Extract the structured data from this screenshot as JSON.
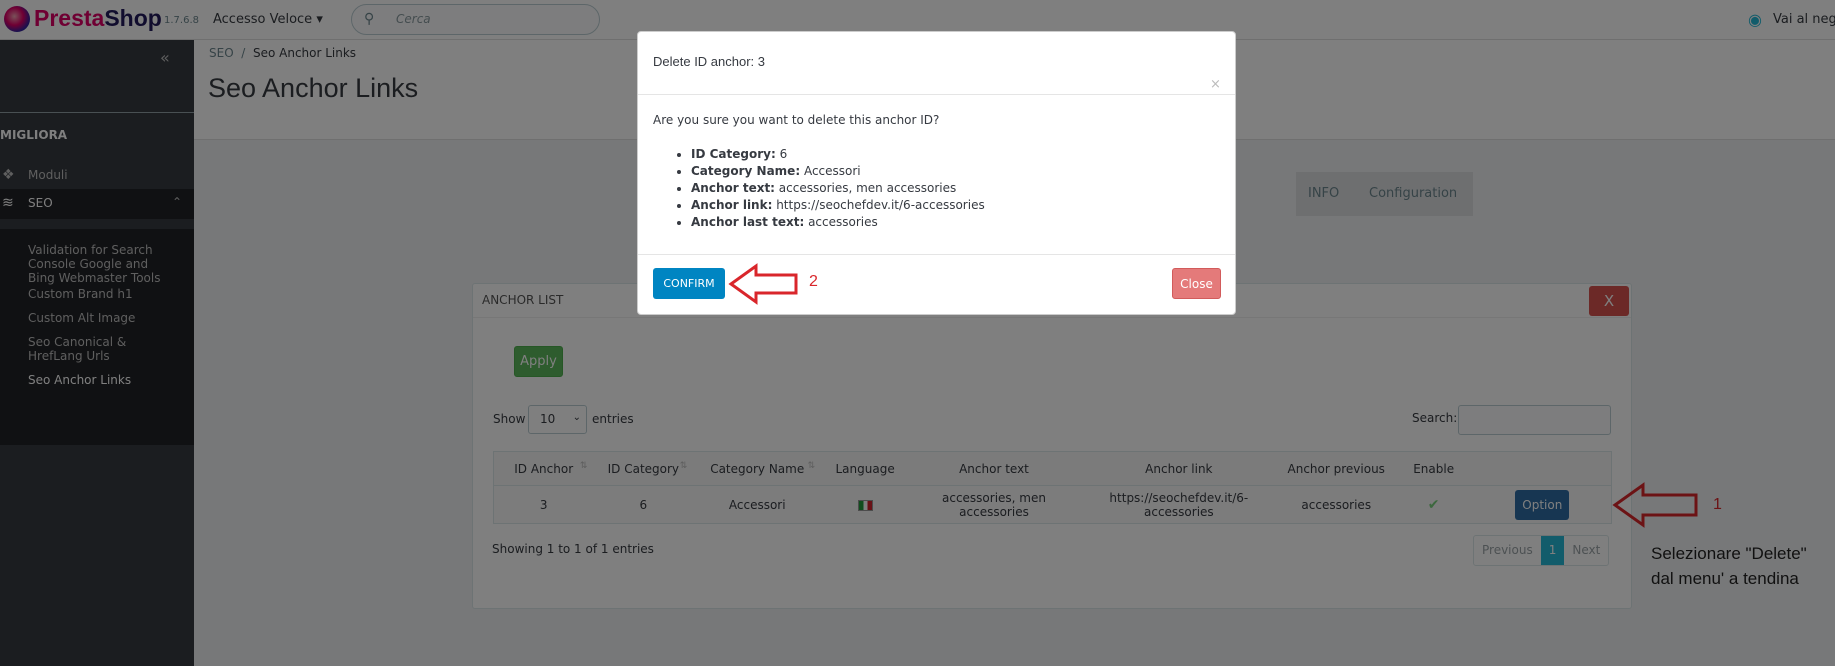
{
  "header": {
    "brand_a": "Presta",
    "brand_b": "Shop",
    "version": "1.7.6.8",
    "quick_access": "Accesso Veloce",
    "search_placeholder": "Cerca",
    "shop_link": "Vai al negozio"
  },
  "sidebar": {
    "section": "MIGLIORA",
    "items": [
      {
        "label": "Moduli",
        "icon": "puzzle-icon"
      },
      {
        "label": "SEO",
        "icon": "seo-icon"
      }
    ],
    "submenu": [
      "Validation for Search Console Google and Bing Webmaster Tools",
      "Custom Brand h1",
      "Custom Alt Image",
      "Seo Canonical & HrefLang Urls",
      "Seo Anchor Links"
    ]
  },
  "page": {
    "breadcrumb_parent": "SEO",
    "breadcrumb_current": "Seo Anchor Links",
    "title": "Seo Anchor Links",
    "tabs": [
      "INFO",
      "Configuration"
    ]
  },
  "panel": {
    "title": "ANCHOR LIST",
    "close_label": "X",
    "apply_label": "Apply",
    "show_label": "Show",
    "entries_value": "10",
    "entries_label": "entries",
    "search_label": "Search:",
    "columns": [
      "ID Anchor",
      "ID Category",
      "Category Name",
      "Language",
      "Anchor text",
      "Anchor link",
      "Anchor previous",
      "Enable",
      ""
    ],
    "row": {
      "id_anchor": "3",
      "id_category": "6",
      "category_name": "Accessori",
      "anchor_text": "accessories, men accessories",
      "anchor_link": "https://seochefdev.it/6-accessories",
      "anchor_previous": "accessories",
      "option_label": "Option"
    },
    "showing": "Showing 1 to 1 of 1 entries",
    "pager": [
      "Previous",
      "1",
      "Next"
    ]
  },
  "annotations": {
    "num1": "1",
    "num2": "2",
    "note_line1": "Selezionare \"Delete\"",
    "note_line2": "dal menu' a tendina"
  },
  "modal": {
    "title": "Delete ID anchor: 3",
    "close_x": "×",
    "question": "Are you sure you want to delete this anchor ID?",
    "details": [
      {
        "key": "ID Category:",
        "value": " 6"
      },
      {
        "key": "Category Name:",
        "value": " Accessori"
      },
      {
        "key": "Anchor text:",
        "value": " accessories, men accessories"
      },
      {
        "key": "Anchor link:",
        "value": " https://seochefdev.it/6-accessories"
      },
      {
        "key": "Anchor last text:",
        "value": " accessories"
      }
    ],
    "confirm_label": "CONFIRM",
    "close_label": "Close"
  },
  "colors": {
    "accent": "#25b9d7",
    "annotation": "#d9262b",
    "confirm": "#0085c2",
    "danger": "#d9534f"
  }
}
